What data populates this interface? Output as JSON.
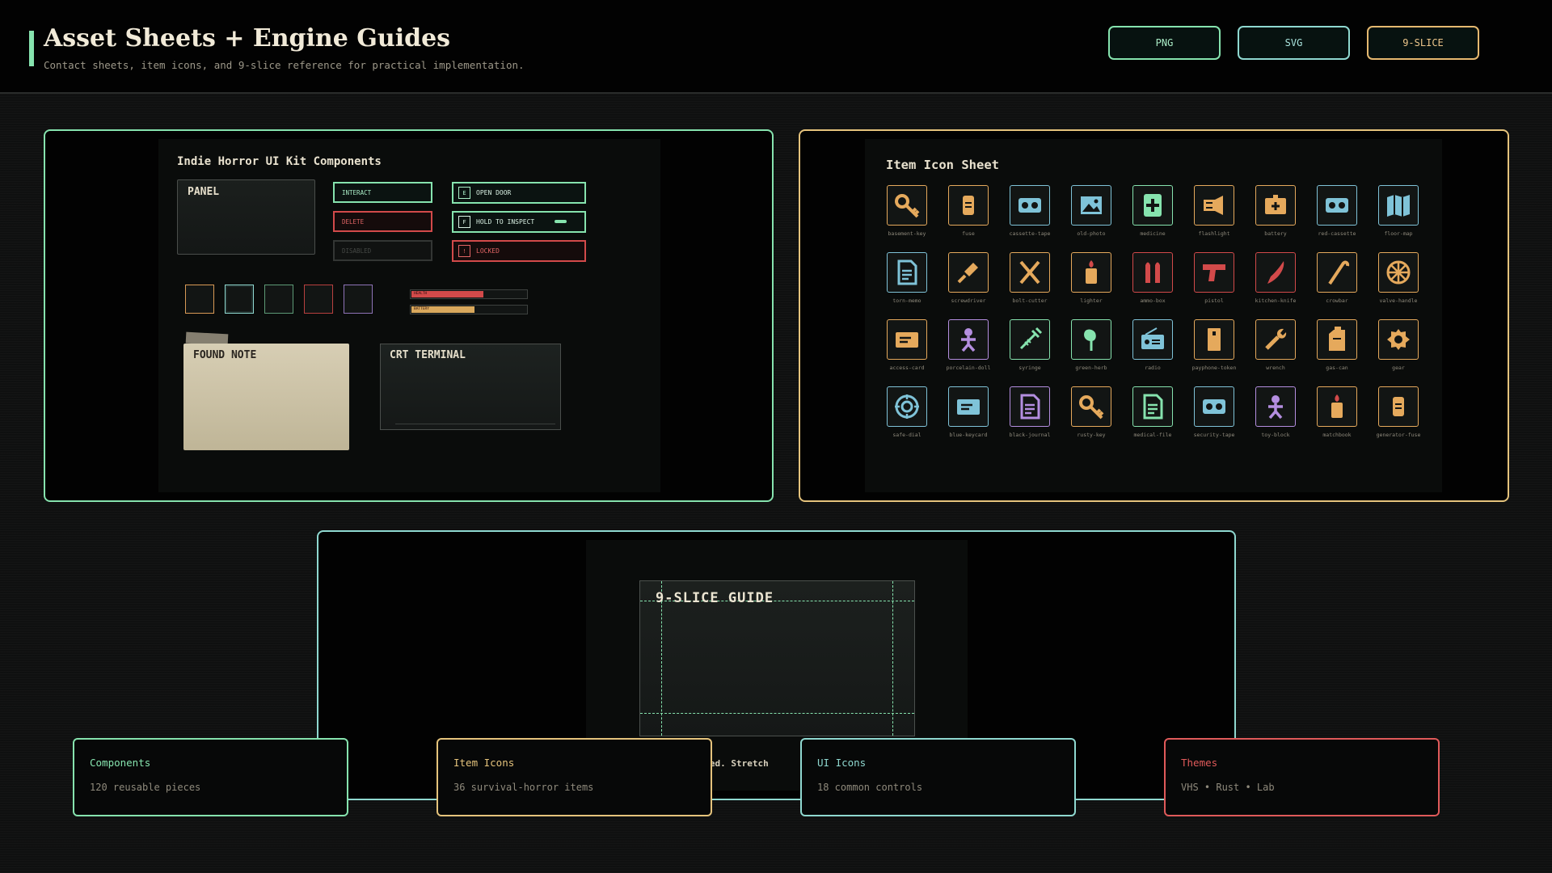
{
  "header": {
    "title": "Asset Sheets + Engine Guides",
    "subtitle": "Contact sheets, item icons, and 9-slice reference for practical implementation.",
    "formats": [
      "PNG",
      "SVG",
      "9-SLICE"
    ]
  },
  "kit": {
    "title": "Indie Horror UI Kit Components",
    "panel_label": "PANEL",
    "buttons": {
      "interact": "INTERACT",
      "delete": "DELETE",
      "disabled": "DISABLED"
    },
    "prompts": [
      {
        "key": "E",
        "label": "OPEN DOOR"
      },
      {
        "key": "F",
        "label": "HOLD TO INSPECT"
      },
      {
        "key": "!",
        "label": "LOCKED"
      }
    ],
    "bars": [
      {
        "label": "HEALTH",
        "value": 0.62,
        "color": "#d24a4a"
      },
      {
        "label": "BATTERY",
        "value": 0.54,
        "color": "#d9a85c"
      }
    ],
    "note_label": "FOUND NOTE",
    "crt_label": "CRT TERMINAL"
  },
  "icon_sheet": {
    "title": "Item Icon Sheet",
    "items": [
      {
        "label": "basement-key",
        "color": "#e5a95c",
        "glyph": "key"
      },
      {
        "label": "fuse",
        "color": "#e5a95c",
        "glyph": "fuse"
      },
      {
        "label": "cassette-tape",
        "color": "#7fc3d8",
        "glyph": "tape"
      },
      {
        "label": "old-photo",
        "color": "#7fc3d8",
        "glyph": "photo"
      },
      {
        "label": "medicine",
        "color": "#86e3ae",
        "glyph": "medicine"
      },
      {
        "label": "flashlight",
        "color": "#e5a95c",
        "glyph": "flashlight"
      },
      {
        "label": "battery",
        "color": "#e5a95c",
        "glyph": "battery"
      },
      {
        "label": "red-cassette",
        "color": "#7fc3d8",
        "glyph": "tape"
      },
      {
        "label": "floor-map",
        "color": "#7fc3d8",
        "glyph": "map"
      },
      {
        "label": "torn-memo",
        "color": "#7fc3d8",
        "glyph": "doc"
      },
      {
        "label": "screwdriver",
        "color": "#e5a95c",
        "glyph": "screwdriver"
      },
      {
        "label": "bolt-cutter",
        "color": "#e5a95c",
        "glyph": "cutter"
      },
      {
        "label": "lighter",
        "color": "#e5a95c",
        "glyph": "lighter"
      },
      {
        "label": "ammo-box",
        "color": "#d24a4a",
        "glyph": "ammo"
      },
      {
        "label": "pistol",
        "color": "#d24a4a",
        "glyph": "pistol"
      },
      {
        "label": "kitchen-knife",
        "color": "#d24a4a",
        "glyph": "knife"
      },
      {
        "label": "crowbar",
        "color": "#e5a95c",
        "glyph": "crowbar"
      },
      {
        "label": "valve-handle",
        "color": "#e5a95c",
        "glyph": "valve"
      },
      {
        "label": "access-card",
        "color": "#e5a95c",
        "glyph": "card"
      },
      {
        "label": "porcelain-doll",
        "color": "#b48ee0",
        "glyph": "doll"
      },
      {
        "label": "syringe",
        "color": "#86e3ae",
        "glyph": "syringe"
      },
      {
        "label": "green-herb",
        "color": "#86e3ae",
        "glyph": "herb"
      },
      {
        "label": "radio",
        "color": "#7fc3d8",
        "glyph": "radio"
      },
      {
        "label": "payphone-token",
        "color": "#e5a95c",
        "glyph": "token"
      },
      {
        "label": "wrench",
        "color": "#e5a95c",
        "glyph": "wrench"
      },
      {
        "label": "gas-can",
        "color": "#e5a95c",
        "glyph": "gascan"
      },
      {
        "label": "gear",
        "color": "#e5a95c",
        "glyph": "gear"
      },
      {
        "label": "safe-dial",
        "color": "#7fc3d8",
        "glyph": "dial"
      },
      {
        "label": "blue-keycard",
        "color": "#7fc3d8",
        "glyph": "card"
      },
      {
        "label": "black-journal",
        "color": "#b48ee0",
        "glyph": "doc"
      },
      {
        "label": "rusty-key",
        "color": "#e5a95c",
        "glyph": "key"
      },
      {
        "label": "medical-file",
        "color": "#86e3ae",
        "glyph": "doc"
      },
      {
        "label": "security-tape",
        "color": "#7fc3d8",
        "glyph": "tape"
      },
      {
        "label": "toy-block",
        "color": "#b48ee0",
        "glyph": "doll"
      },
      {
        "label": "matchbook",
        "color": "#e5a95c",
        "glyph": "lighter"
      },
      {
        "label": "generator-fuse",
        "color": "#e5a95c",
        "glyph": "fuse"
      }
    ]
  },
  "nine_slice": {
    "title": "9-SLICE GUIDE",
    "caption": "fixed. Stretch"
  },
  "stats": [
    {
      "title": "Components",
      "desc": "120 reusable pieces",
      "color": "#86e3ae"
    },
    {
      "title": "Item Icons",
      "desc": "36 survival-horror items",
      "color": "#e5c37c"
    },
    {
      "title": "UI Icons",
      "desc": "18 common controls",
      "color": "#8fd8d0"
    },
    {
      "title": "Themes",
      "desc": "VHS • Rust • Lab",
      "color": "#e05a5a"
    }
  ]
}
